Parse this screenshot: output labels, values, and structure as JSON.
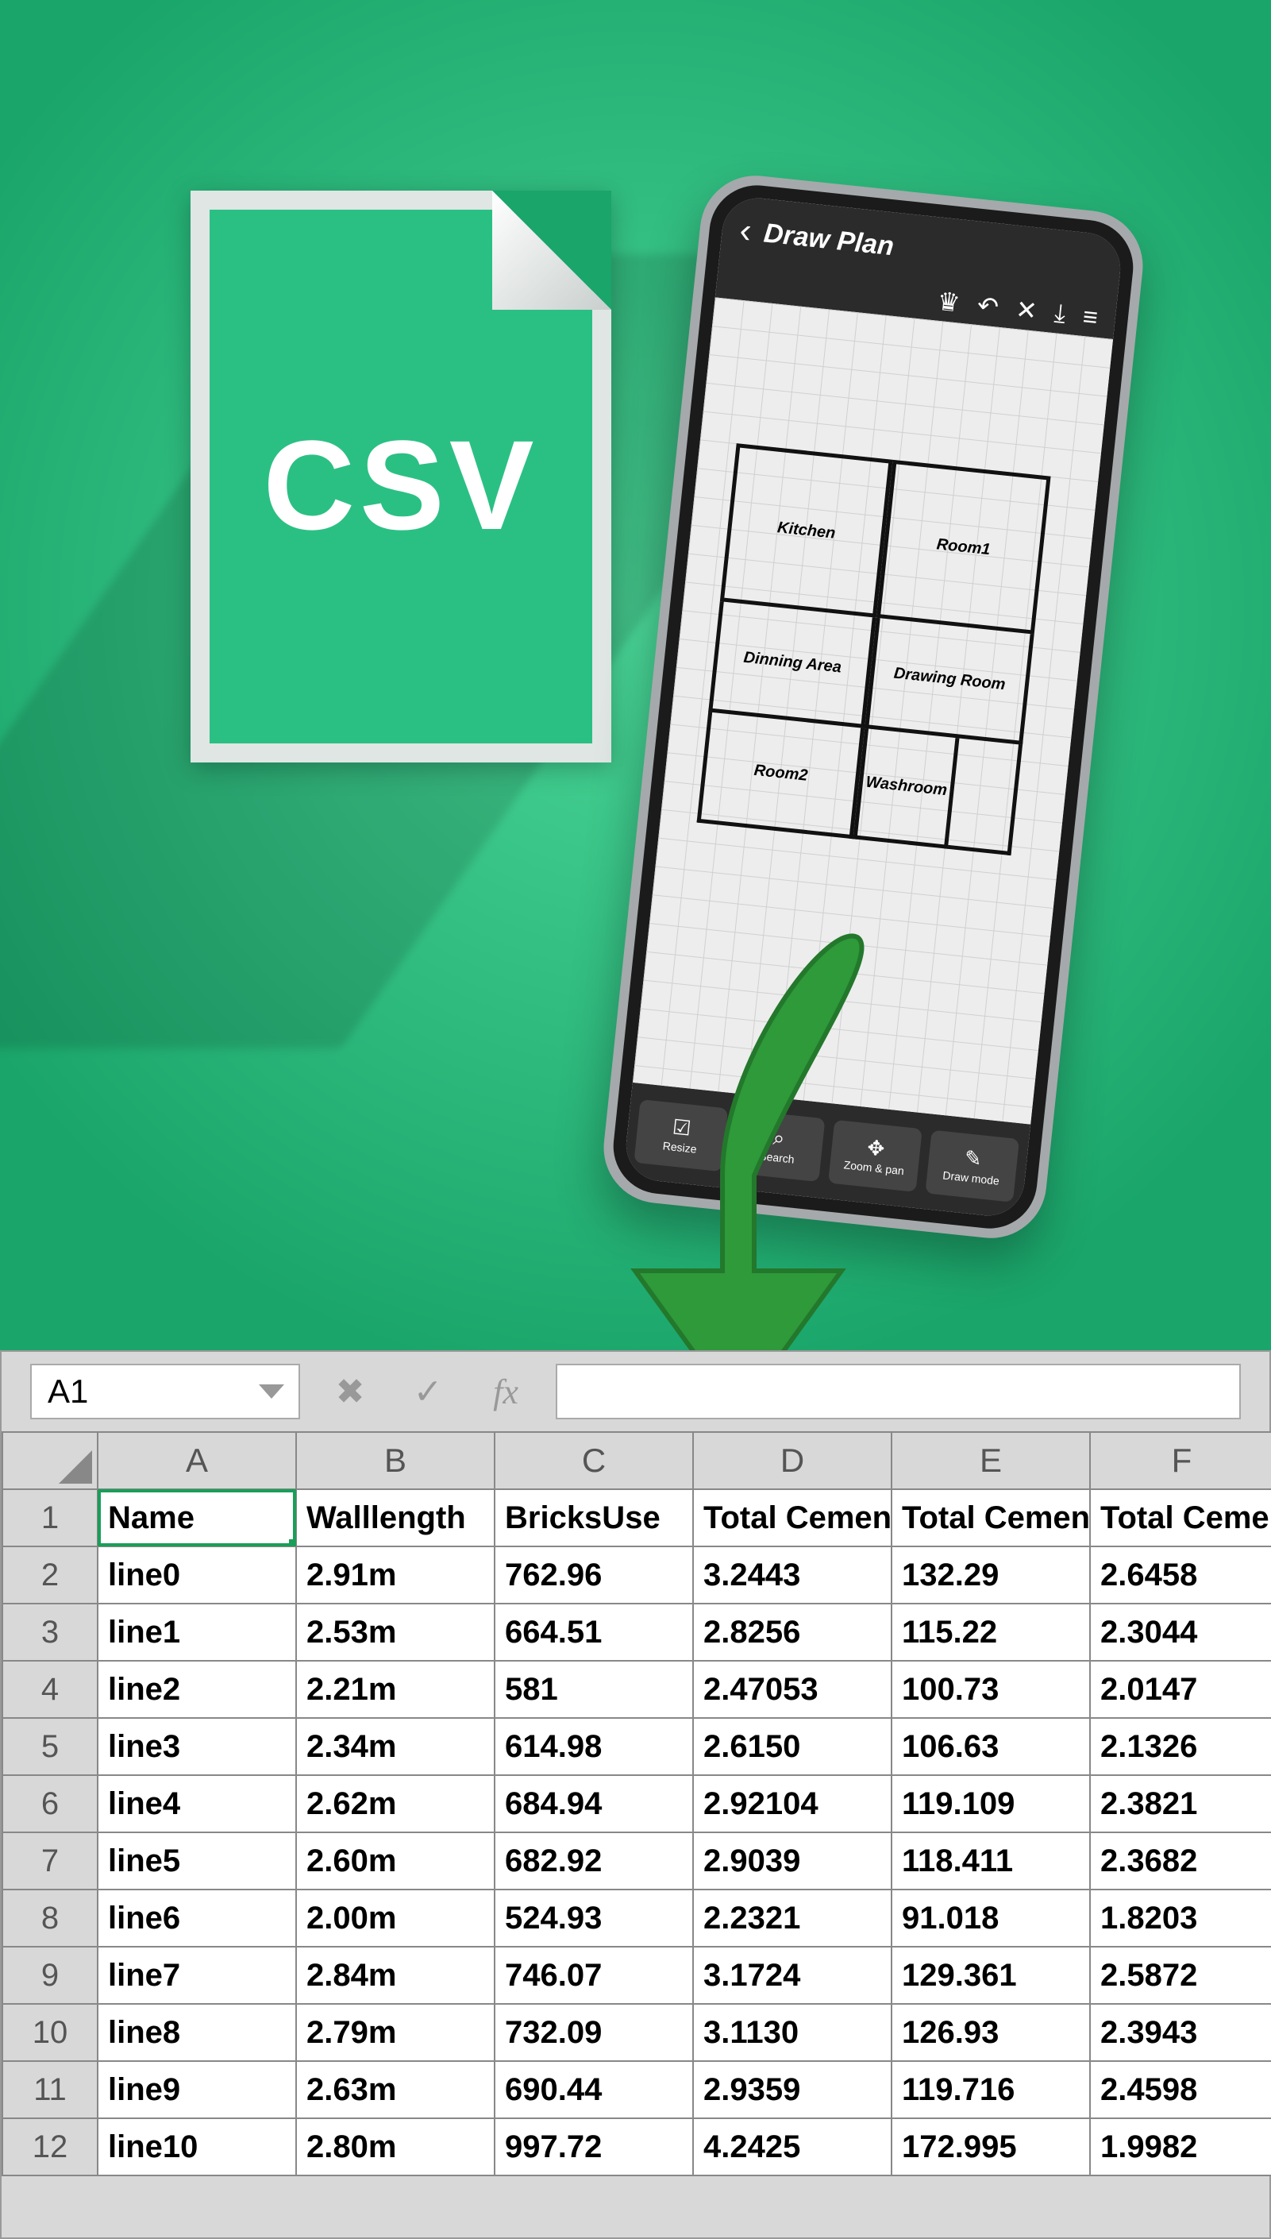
{
  "promo": {
    "csv_label": "CSV"
  },
  "phone": {
    "title": "Draw Plan",
    "icons": {
      "back": "‹",
      "crown": "♛",
      "undo": "↶",
      "close": "✕",
      "download": "⤓",
      "menu": "≡"
    },
    "rooms": {
      "kitchen": "Kitchen",
      "room1": "Room1",
      "dining": "Dinning Area",
      "drawing": "Drawing Room",
      "room2": "Room2",
      "washroom": "Washroom"
    },
    "tools": [
      {
        "icon": "☑",
        "label": "Resize"
      },
      {
        "icon": "⌕",
        "label": "Search"
      },
      {
        "icon": "✥",
        "label": "Zoom & pan"
      },
      {
        "icon": "✎",
        "label": "Draw mode"
      }
    ]
  },
  "sheet": {
    "name_box": "A1",
    "fx_label": "fx",
    "columns": [
      "A",
      "B",
      "C",
      "D",
      "E",
      "F"
    ],
    "header_row": [
      "Name",
      "Walllength",
      "BricksUse",
      "Total Cemen",
      "Total Cemen",
      "Total Cemen"
    ],
    "rows": [
      {
        "n": "2",
        "c": [
          "line0",
          "2.91m",
          "762.96",
          "3.2443",
          "132.29",
          "2.6458"
        ]
      },
      {
        "n": "3",
        "c": [
          "line1",
          "2.53m",
          "664.51",
          "2.8256",
          "115.22",
          "2.3044"
        ]
      },
      {
        "n": "4",
        "c": [
          "line2",
          "2.21m",
          "581",
          "2.47053",
          "100.73",
          "2.0147"
        ]
      },
      {
        "n": "5",
        "c": [
          "line3",
          "2.34m",
          "614.98",
          "2.6150",
          "106.63",
          "2.1326"
        ]
      },
      {
        "n": "6",
        "c": [
          "line4",
          "2.62m",
          "684.94",
          "2.92104",
          "119.109",
          "2.3821"
        ]
      },
      {
        "n": "7",
        "c": [
          "line5",
          "2.60m",
          "682.92",
          "2.9039",
          "118.411",
          "2.3682"
        ]
      },
      {
        "n": "8",
        "c": [
          "line6",
          "2.00m",
          "524.93",
          "2.2321",
          "91.018",
          "1.8203"
        ]
      },
      {
        "n": "9",
        "c": [
          "line7",
          "2.84m",
          "746.07",
          "3.1724",
          "129.361",
          "2.5872"
        ]
      },
      {
        "n": "10",
        "c": [
          "line8",
          "2.79m",
          "732.09",
          "3.1130",
          "126.93",
          "2.3943"
        ]
      },
      {
        "n": "11",
        "c": [
          "line9",
          "2.63m",
          "690.44",
          "2.9359",
          "119.716",
          "2.4598"
        ]
      },
      {
        "n": "12",
        "c": [
          "line10",
          "2.80m",
          "997.72",
          "4.2425",
          "172.995",
          "1.9982"
        ]
      }
    ]
  }
}
